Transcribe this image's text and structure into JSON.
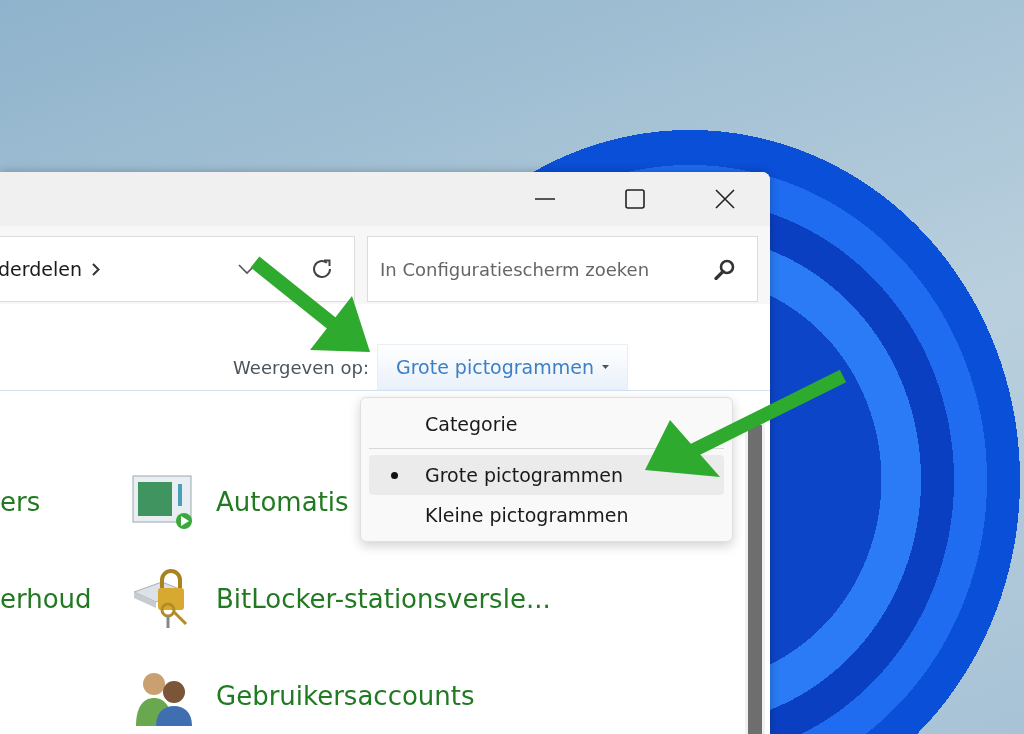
{
  "address": {
    "breadcrumb": "derdelen"
  },
  "search": {
    "placeholder": "In Configuratiescherm zoeken"
  },
  "view_by": {
    "label": "Weergeven op:",
    "value": "Grote pictogrammen"
  },
  "menu": {
    "items": [
      {
        "label": "Categorie",
        "selected": false
      },
      {
        "label": "Grote pictogrammen",
        "selected": true
      },
      {
        "label": "Kleine pictogrammen",
        "selected": false
      }
    ]
  },
  "rows": [
    {
      "left": "ers",
      "label": "Automatis",
      "kind": "autoplay"
    },
    {
      "left": "erhoud",
      "label": "BitLocker-stationsversle...",
      "kind": "bitlocker"
    },
    {
      "label": "Gebruikersaccounts",
      "kind": "users"
    }
  ]
}
